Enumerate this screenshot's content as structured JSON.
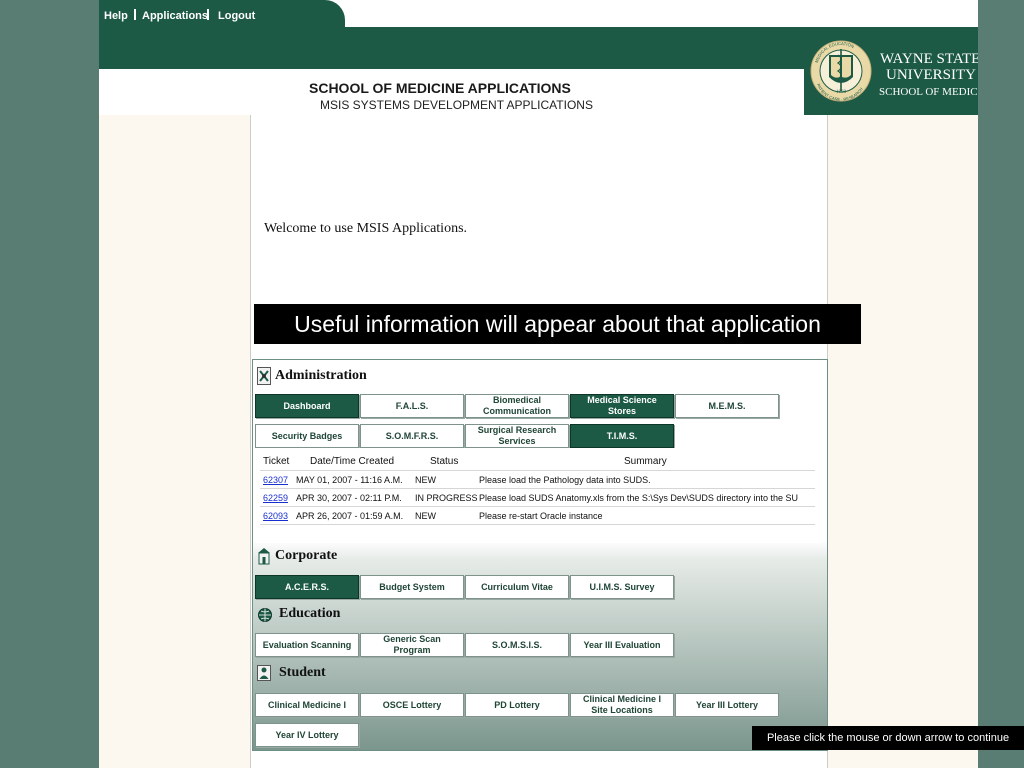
{
  "nav": {
    "help": "Help",
    "applications": "Applications",
    "logout": "Logout"
  },
  "header": {
    "title": "SCHOOL OF MEDICINE APPLICATIONS",
    "subtitle": "MSIS SYSTEMS DEVELOPMENT APPLICATIONS",
    "university_line1": "WAYNE STATE",
    "university_line2": "UNIVERSITY",
    "school": "SCHOOL OF MEDICINE",
    "seal_text_top": "MEDICAL EDUCATION",
    "seal_text_bottom": "PATIENT CARE · RESEARCH",
    "seal_year": "1868"
  },
  "welcome": "Welcome to use MSIS Applications.",
  "callout": "Useful information will appear about that application",
  "sections": {
    "administration": {
      "label": "Administration",
      "buttons": [
        "Dashboard",
        "F.A.L.S.",
        "Biomedical Communication",
        "Medical Science Stores",
        "M.E.M.S.",
        "Security Badges",
        "S.O.M.F.R.S.",
        "Surgical Research Services",
        "T.I.M.S."
      ]
    },
    "corporate": {
      "label": "Corporate",
      "buttons": [
        "A.C.E.R.S.",
        "Budget System",
        "Curriculum Vitae",
        "U.I.M.S. Survey"
      ]
    },
    "education": {
      "label": "Education",
      "buttons": [
        "Evaluation Scanning",
        "Generic Scan Program",
        "S.O.M.S.I.S.",
        "Year III Evaluation"
      ]
    },
    "student": {
      "label": "Student",
      "buttons": [
        "Clinical Medicine I",
        "OSCE Lottery",
        "PD Lottery",
        "Clinical Medicine I Site Locations",
        "Year III Lottery",
        "Year IV Lottery"
      ]
    }
  },
  "tickets": {
    "headers": {
      "ticket": "Ticket",
      "date": "Date/Time Created",
      "status": "Status",
      "summary": "Summary"
    },
    "rows": [
      {
        "ticket": "62307",
        "date": "MAY 01, 2007 - 11:16 A.M.",
        "status": "NEW",
        "summary": "Please load the Pathology data into SUDS."
      },
      {
        "ticket": "62259",
        "date": "APR 30, 2007 - 02:11 P.M.",
        "status": "IN PROGRESS",
        "summary": "Please load SUDS Anatomy.xls from the S:\\Sys Dev\\SUDS directory into the SU"
      },
      {
        "ticket": "62093",
        "date": "APR 26, 2007 - 01:59 A.M.",
        "status": "NEW",
        "summary": "Please re-start Oracle instance"
      }
    ]
  },
  "continue_hint": "Please click the mouse or down arrow to continue",
  "colors": {
    "brand_green": "#1c5a46",
    "background": "#5a7d73",
    "side_column": "#fcf8f0",
    "link_blue": "#1a2fd0"
  }
}
